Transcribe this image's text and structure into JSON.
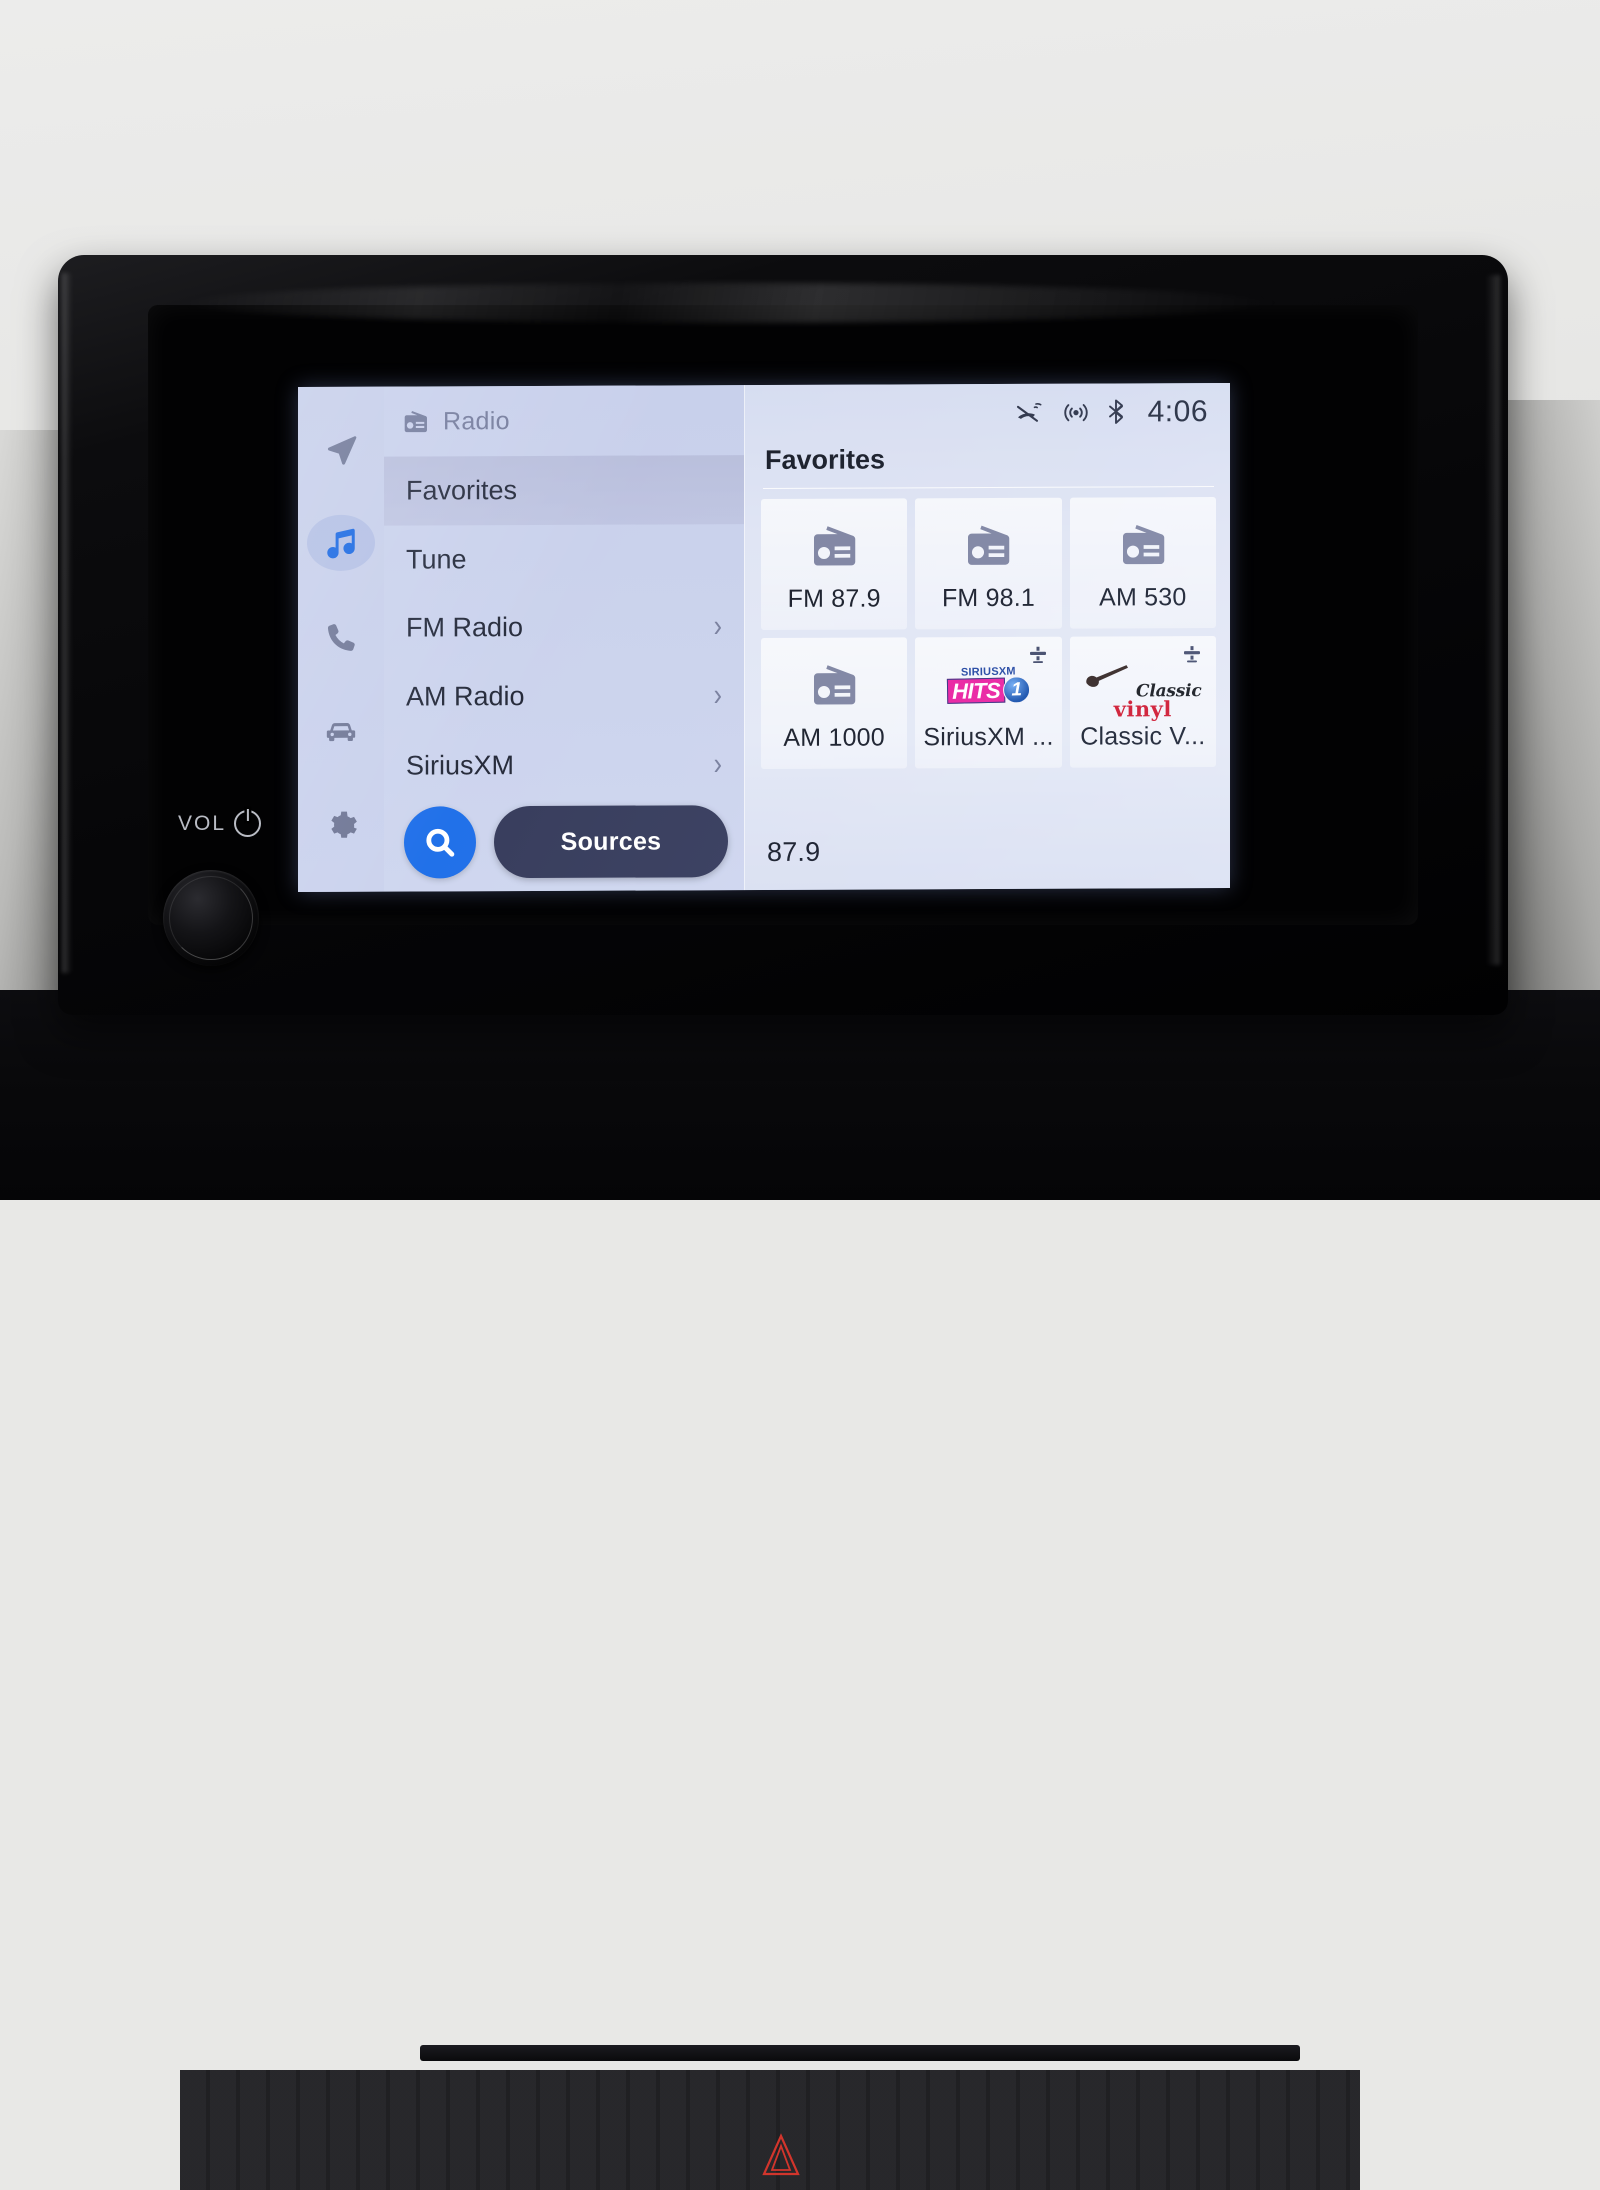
{
  "hardware": {
    "vol_label": "VOL",
    "power_icon": "power-icon",
    "knob": "volume-knob",
    "hazard_icon": "hazard-triangle-icon"
  },
  "sidebar": {
    "items": [
      {
        "name": "navigation",
        "icon": "navigation-arrow-icon",
        "active": false
      },
      {
        "name": "media",
        "icon": "music-note-icon",
        "active": true
      },
      {
        "name": "phone",
        "icon": "phone-icon",
        "active": false
      },
      {
        "name": "vehicle",
        "icon": "car-icon",
        "active": false
      },
      {
        "name": "settings",
        "icon": "gear-icon",
        "active": false
      }
    ]
  },
  "menu": {
    "header": {
      "icon": "radio-icon",
      "title": "Radio"
    },
    "items": [
      {
        "label": "Favorites",
        "selected": true,
        "chevron": ""
      },
      {
        "label": "Tune",
        "selected": false,
        "chevron": ""
      },
      {
        "label": "FM Radio",
        "selected": false,
        "chevron": "›"
      },
      {
        "label": "AM Radio",
        "selected": false,
        "chevron": "›"
      },
      {
        "label": "SiriusXM",
        "selected": false,
        "chevron": "›"
      }
    ],
    "search_icon": "search-icon",
    "sources_label": "Sources"
  },
  "status_bar": {
    "icons": [
      "mute-phone-icon",
      "signal-waves-icon",
      "bluetooth-icon"
    ],
    "time": "4:06"
  },
  "content": {
    "title": "Favorites",
    "favorites": [
      {
        "label": "FM 87.9",
        "art": "radio-icon",
        "satellite": false
      },
      {
        "label": "FM 98.1",
        "art": "radio-icon",
        "satellite": false
      },
      {
        "label": "AM 530",
        "art": "radio-icon",
        "satellite": false
      },
      {
        "label": "AM 1000",
        "art": "radio-icon",
        "satellite": false
      },
      {
        "label": "SiriusXM ...",
        "art": "siriusxm-hits1-logo",
        "satellite": true,
        "logo": {
          "top": "SIRIUSXM",
          "main": "HITS",
          "badge": "1"
        }
      },
      {
        "label": "Classic V...",
        "art": "classic-vinyl-logo",
        "satellite": true,
        "logo": {
          "script": "Classic",
          "word": "vinyl"
        }
      }
    ],
    "now_playing": "87.9"
  },
  "colors": {
    "accent_blue": "#1569e8",
    "sources_navy": "#2e3354",
    "screen_bg": "#c6ceea",
    "panel_bg": "#dee3f3",
    "text_dark": "#10141f",
    "text_muted": "#6e7596",
    "hits1_pink": "#e8179b",
    "vinyl_red": "#cc0a1e"
  }
}
